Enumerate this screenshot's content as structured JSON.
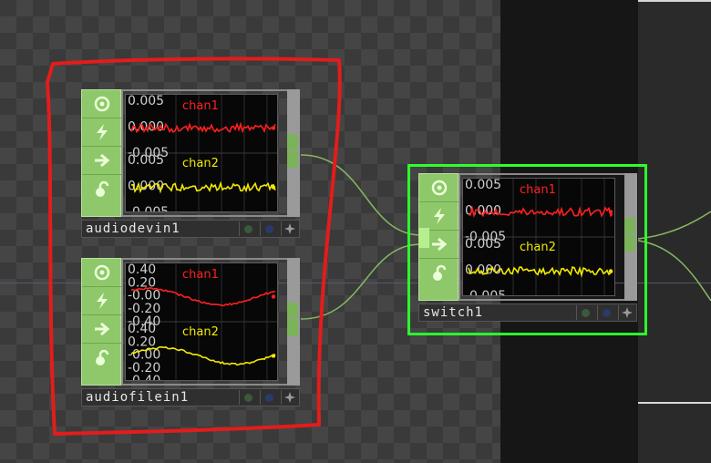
{
  "nodes": {
    "audiodevin1": {
      "name": "audiodevin1",
      "channels": [
        {
          "label": "chan1",
          "color": "#ff2020",
          "ticks": [
            "0.005",
            "0.000",
            "-0.005"
          ]
        },
        {
          "label": "chan2",
          "color": "#f2ea00",
          "ticks": [
            "0.005",
            "0.000",
            "-0.005"
          ]
        }
      ]
    },
    "audiofilein1": {
      "name": "audiofilein1",
      "channels": [
        {
          "label": "chan1",
          "color": "#ff2020",
          "ticks": [
            "0.40",
            "0.20",
            "-0.00",
            "-0.20",
            "-0.40"
          ]
        },
        {
          "label": "chan2",
          "color": "#f2ea00",
          "ticks": [
            "0.40",
            "0.20",
            "-0.00",
            "-0.20",
            "-0.40"
          ]
        }
      ]
    },
    "switch1": {
      "name": "switch1",
      "channels": [
        {
          "label": "chan1",
          "color": "#ff2020",
          "ticks": [
            "0.005",
            "0.000",
            "-0.005"
          ]
        },
        {
          "label": "chan2",
          "color": "#f2ea00",
          "ticks": [
            "0.005",
            "0.000",
            "-0.005"
          ]
        }
      ]
    }
  },
  "icons": {
    "viewer": "target-icon",
    "bypass": "lightning-icon",
    "cook": "arrow-right-icon",
    "lock": "lock-icon",
    "footer": [
      "display-flag-icon",
      "render-flag-icon",
      "pin-icon"
    ]
  },
  "colors": {
    "selection": "#2dff2d",
    "annotation": "#e31c1c",
    "node_green": "#8fc86a",
    "wire": "#86b862"
  }
}
